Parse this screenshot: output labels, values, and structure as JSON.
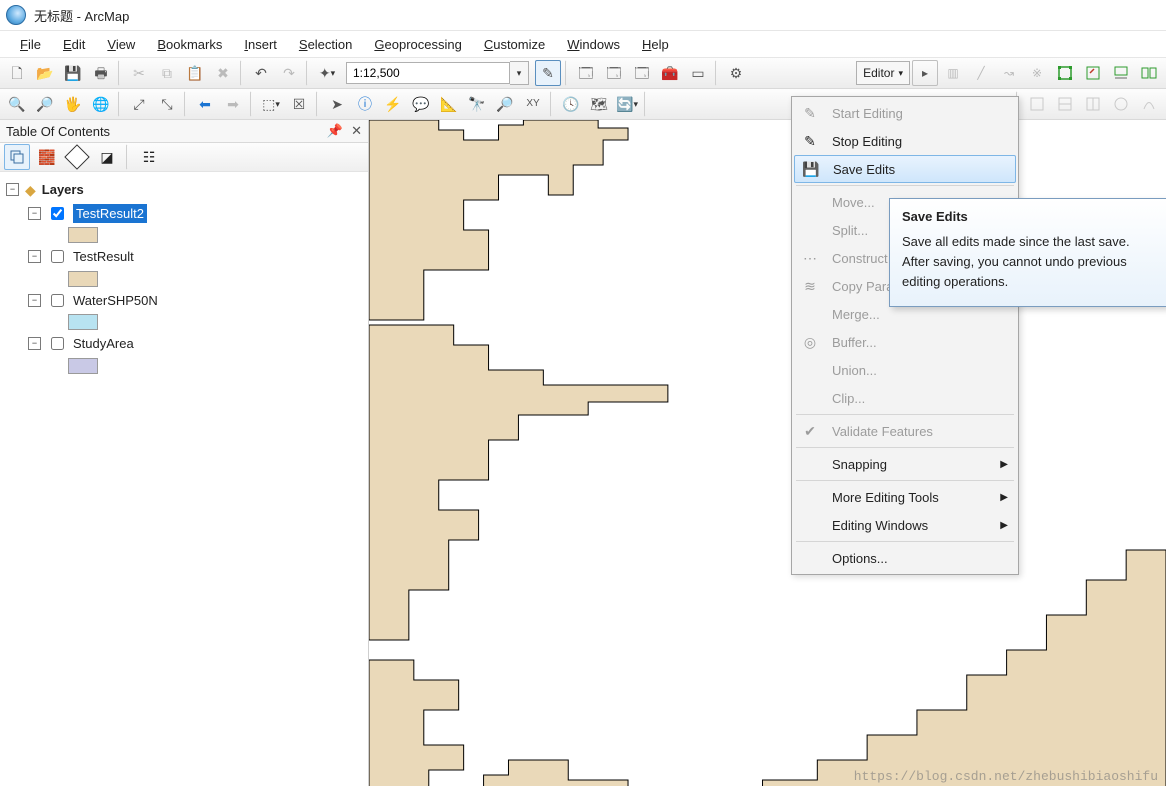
{
  "title": {
    "text": "无标题 - ArcMap"
  },
  "menus": [
    "File",
    "Edit",
    "View",
    "Bookmarks",
    "Insert",
    "Selection",
    "Geoprocessing",
    "Customize",
    "Windows",
    "Help"
  ],
  "scale": {
    "value": "1:12,500"
  },
  "editor_button": {
    "label": "Editor"
  },
  "toc": {
    "title": "Table Of Contents",
    "root_label": "Layers",
    "layers": [
      {
        "name": "TestResult2",
        "checked": true,
        "selected": true,
        "swatch": "#E9D8B8"
      },
      {
        "name": "TestResult",
        "checked": false,
        "selected": false,
        "swatch": "#E9D8B8"
      },
      {
        "name": "WaterSHP50N",
        "checked": false,
        "selected": false,
        "swatch": "#B8E3F1"
      },
      {
        "name": "StudyArea",
        "checked": false,
        "selected": false,
        "swatch": "#C9C9E6"
      }
    ]
  },
  "editor_menu": {
    "items": [
      {
        "label": "Start Editing",
        "disabled": true,
        "icon": "pencil"
      },
      {
        "label": "Stop Editing",
        "disabled": false,
        "icon": "pencil-stop"
      },
      {
        "label": "Save Edits",
        "disabled": false,
        "icon": "save",
        "hover": true
      },
      {
        "sep": true
      },
      {
        "label": "Move...",
        "disabled": true
      },
      {
        "label": "Split...",
        "disabled": true
      },
      {
        "label": "Construct Points...",
        "disabled": true,
        "icon": "construct"
      },
      {
        "label": "Copy Parallel...",
        "disabled": true,
        "icon": "parallel"
      },
      {
        "label": "Merge...",
        "disabled": true
      },
      {
        "label": "Buffer...",
        "disabled": true,
        "icon": "buffer"
      },
      {
        "label": "Union...",
        "disabled": true
      },
      {
        "label": "Clip...",
        "disabled": true
      },
      {
        "sep": true
      },
      {
        "label": "Validate Features",
        "disabled": true,
        "icon": "validate"
      },
      {
        "sep": true
      },
      {
        "label": "Snapping",
        "disabled": false,
        "sub": true
      },
      {
        "sep": true
      },
      {
        "label": "More Editing Tools",
        "disabled": false,
        "sub": true
      },
      {
        "label": "Editing Windows",
        "disabled": false,
        "sub": true
      },
      {
        "sep": true
      },
      {
        "label": "Options...",
        "disabled": false
      }
    ]
  },
  "tooltip": {
    "title": "Save Edits",
    "body": "Save all edits made since the last save. After saving, you cannot undo previous editing operations."
  },
  "watermark": "https://blog.csdn.net/zhebushibiaoshifu",
  "colors": {
    "poly_fill": "#EAD9B9",
    "poly_stroke": "#000000"
  }
}
